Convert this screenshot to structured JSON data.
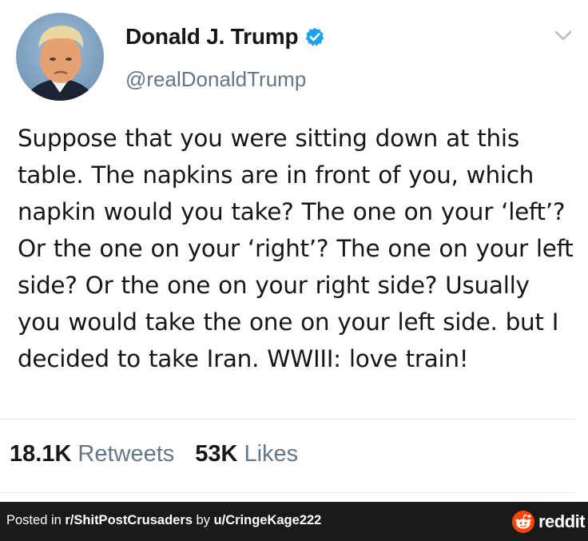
{
  "tweet": {
    "display_name": "Donald J. Trump",
    "handle": "@realDonaldTrump",
    "text": "Suppose that you were sitting down at this table. The napkins are in front of you, which napkin would you take? The one on your ‘left’? Or the one on your ‘right’? The one on your left side? Or the one on your right side? Usually you would take the one on your left side. but I decided to take Iran. WWIII: love train!",
    "retweets_count": "18.1K",
    "retweets_label": "Retweets",
    "likes_count": "53K",
    "likes_label": "Likes",
    "verified_color": "#1da1f2",
    "avatar_icon": "avatar-photo",
    "menu_icon": "chevron-down-icon"
  },
  "footer": {
    "posted_prefix": "Posted in ",
    "subreddit": "r/ShitPostCrusaders",
    "by_text": " by ",
    "user": "u/CringeKage222",
    "brand": "reddit",
    "brand_color": "#ff4500"
  }
}
